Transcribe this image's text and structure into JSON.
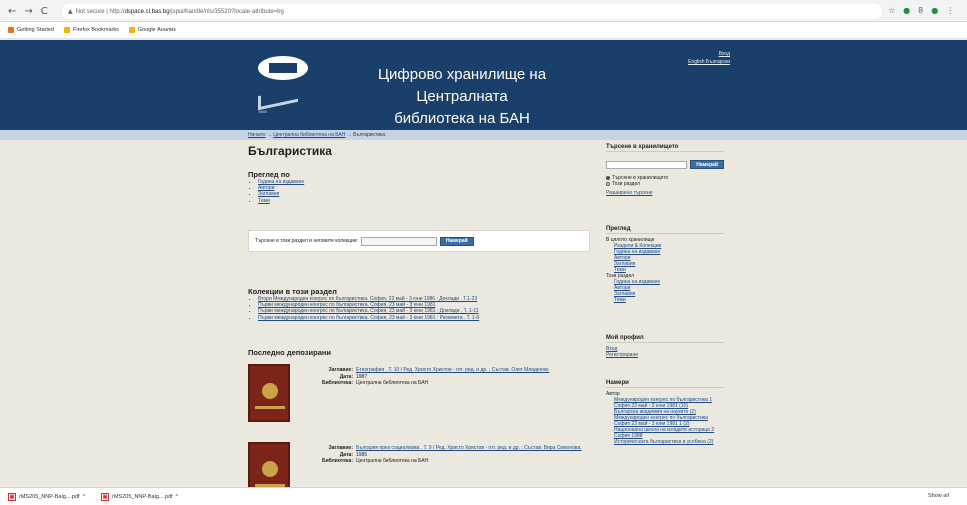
{
  "browser": {
    "nav": {
      "back": "←",
      "forward": "→",
      "reload": "C"
    },
    "warning": "Not secure",
    "url_prefix": "http://",
    "url_host": "dspace.cl.bas.bg",
    "url_rest": "/jspui/handle/nls/35520?locale-attribute=bg",
    "icons_right": [
      "☆",
      "●",
      "8",
      "●",
      "⋮"
    ],
    "bookmarks": [
      "Getting Started",
      "Firefox Bookmarks",
      "Google Анализ"
    ],
    "bookmark_colors": [
      "#e8711a",
      "#f2b600",
      "#f2b600"
    ]
  },
  "header": {
    "title_line1": "Цифрово хранилище на Централната",
    "title_line2": "библиотека на БАН",
    "logo_caption": "1869",
    "login": "Вход",
    "language": "English Български"
  },
  "breadcrumb": {
    "items": [
      "Начало",
      "Централна библиотека на БАН",
      "Българистика"
    ],
    "sep": "→"
  },
  "main": {
    "title": "Българистика",
    "browse_heading": "Преглед по",
    "browse_items": [
      "Година на издаване",
      "Автори",
      "Заглавия",
      "Теми"
    ],
    "search_label": "Търсене в този раздел и неговите колекции:",
    "search_button": "Намерай",
    "collections_heading": "Колекции в този раздел",
    "collections": [
      "Втори Международен конгрес по българистика. София, 23 май - 3 юни 1986 : Доклади . Т.1-23",
      "Първи международен конгрес по българистика. София, 23 май - 3 юни 1981",
      "Първи международен конгрес по българистика. София, 23 май - 3 юни 1981 : Доклади . Т. 1-11",
      "Първи международен конгрес по българистика. София, 23 май - 3 юни 1981 : Резюмета . Т. 1-6"
    ],
    "recent_heading": "Последно депозирани",
    "items": [
      {
        "title_label": "Заглавие:",
        "title": "Етнография . Т. 10 / Ред. Христо Христов - отг. ред. и др. ; Състав. Олег Младенов.",
        "date_label": "Дата:",
        "date": "1987",
        "library_label": "Библиотека:",
        "library": "Централна библиотека на БАН"
      },
      {
        "title_label": "Заглавие:",
        "title": "България през социализма . Т. 9 / Ред. Христо Христов - отг. ред. и др. ; Състав. Вяра Симонова.",
        "date_label": "Дата:",
        "date": "1985",
        "library_label": "Библиотека:",
        "library": "Централна библиотека на БАН"
      }
    ]
  },
  "sidebar": {
    "search_heading": "Търсене в хранилището",
    "search_button": "Намерай",
    "radio_all": "Търсене в хранилището",
    "radio_section": "Този раздел",
    "advanced": "Разширено търсене",
    "browse_heading": "Преглед",
    "whole_repo": "В цялото хранилище",
    "repo_links": [
      "Раздели & Колекции",
      "Година на издаване",
      "Автори",
      "Заглавия",
      "Теми"
    ],
    "this_section": "Този раздел",
    "section_links": [
      "Година на издаване",
      "Автори",
      "Заглавия",
      "Теми"
    ],
    "profile_heading": "Мой профил",
    "profile_links": [
      "Вход",
      "Регистриране"
    ],
    "find_heading": "Намери",
    "author_label": "Автор",
    "facets": [
      "Международен конгрес по българистика 1 София 23 май - 3 юни 1981 (10)",
      "Българска академия на науките (2)",
      "Международен конгрес по българистика София 23 май - 3 юни 1981 1 (2)",
      "Национална школа на младите историци 2 София 1988",
      "Историческата българистика в услбена (2)"
    ]
  },
  "downloads": {
    "files": [
      "rMS205_NNP-Balg....pdf",
      "rMS205_NNP-Balg....pdf"
    ],
    "show_all": "Show all"
  }
}
